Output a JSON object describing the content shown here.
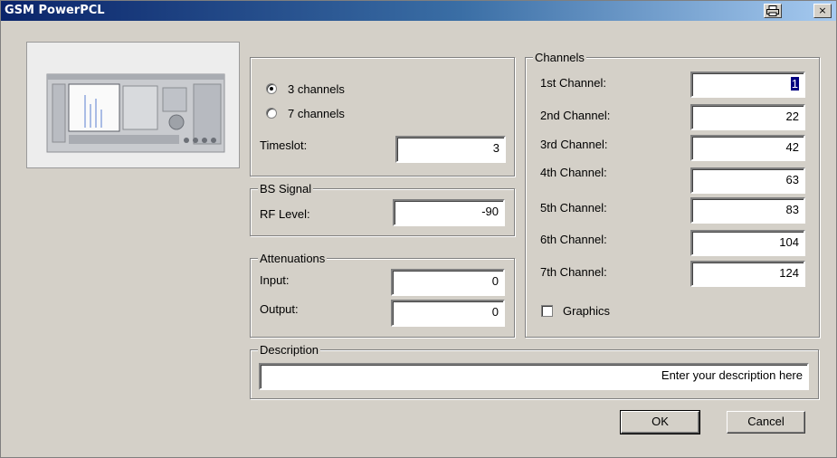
{
  "window": {
    "title": "GSM PowerPCL",
    "print_icon": "printer-icon",
    "close_label": "×"
  },
  "mode": {
    "radio1_label": "3 channels",
    "radio2_label": "7 channels",
    "selected": "3 channels",
    "timeslot_label": "Timeslot:",
    "timeslot_value": "3"
  },
  "bs_signal": {
    "legend": "BS Signal",
    "rf_label": "RF Level:",
    "rf_value": "-90"
  },
  "attenuations": {
    "legend": "Attenuations",
    "input_label": "Input:",
    "input_value": "0",
    "output_label": "Output:",
    "output_value": "0"
  },
  "channels": {
    "legend": "Channels",
    "items": [
      {
        "label": "1st Channel:",
        "value": "1"
      },
      {
        "label": "2nd Channel:",
        "value": "22"
      },
      {
        "label": "3rd Channel:",
        "value": "42"
      },
      {
        "label": "4th Channel:",
        "value": "63"
      },
      {
        "label": "5th Channel:",
        "value": "83"
      },
      {
        "label": "6th Channel:",
        "value": "104"
      },
      {
        "label": "7th Channel:",
        "value": "124"
      }
    ],
    "graphics_label": "Graphics",
    "graphics_checked": false
  },
  "description": {
    "legend": "Description",
    "value": "Enter your description here"
  },
  "buttons": {
    "ok": "OK",
    "cancel": "Cancel"
  }
}
